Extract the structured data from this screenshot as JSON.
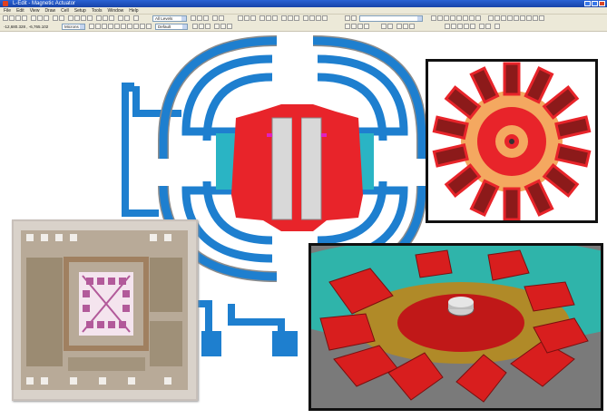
{
  "window": {
    "title": "L-Edit - Magnetic Actuator"
  },
  "menu": [
    "File",
    "Edit",
    "View",
    "Draw",
    "Cell",
    "Setup",
    "Tools",
    "Window",
    "Help"
  ],
  "toolbar": {
    "layers_combo": "All Levels",
    "coordinates": "-12,680.328 , -6,765.102",
    "unit_combo": "Microns",
    "style_combo": "Default"
  },
  "colors": {
    "coil_blue": "#1e7fcf",
    "magnet_red": "#e8242a",
    "comb_olive": "#b29a2a",
    "accent_teal": "#2ab4c4",
    "rotor_orange": "#f4a860",
    "rotor_dark": "#8c1a1a"
  }
}
